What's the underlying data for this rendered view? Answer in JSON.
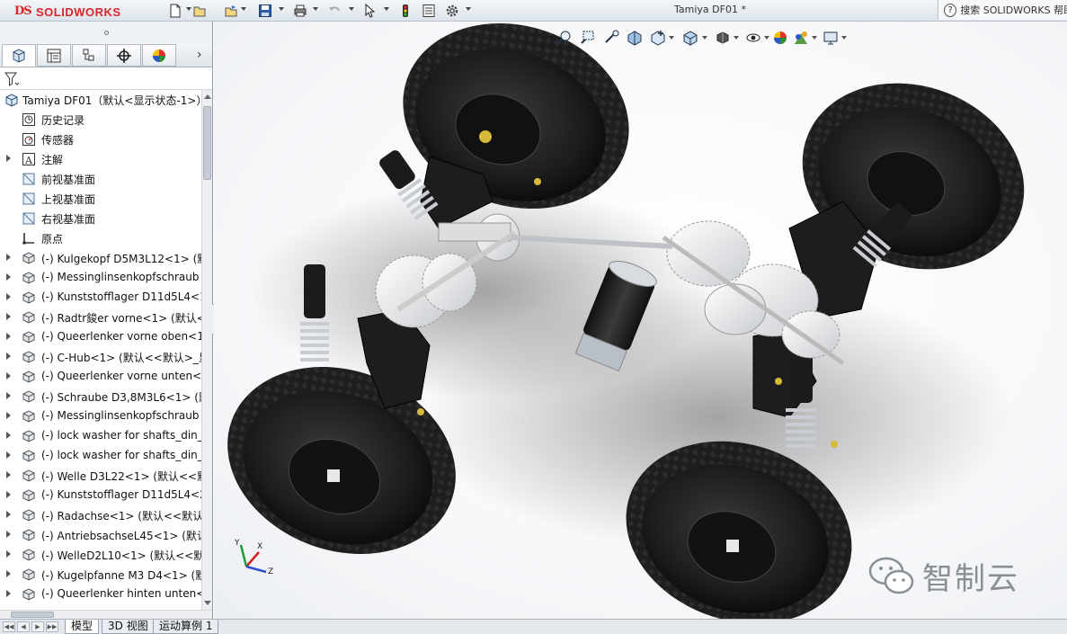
{
  "window": {
    "logo_ds": "DS",
    "logo_brand": "SOLIDWORKS",
    "document_title": "Tamiya DF01 *",
    "search_label": "搜索 SOLIDWORKS 帮助"
  },
  "toolbar": {
    "icons": [
      "new-document-icon",
      "open-folder-icon",
      "save-icon",
      "print-icon",
      "undo-icon",
      "select-arrow-icon",
      "rebuild-traffic-light-icon",
      "file-properties-icon",
      "options-gear-icon"
    ]
  },
  "feature_manager": {
    "tabs": [
      "featuremanager-tree-icon",
      "property-manager-icon",
      "configuration-manager-icon",
      "dimxpert-manager-icon",
      "display-manager-icon"
    ],
    "filter_icon": "filter-funnel-icon",
    "root": "Tamiya DF01（默认<显示状态-1>）",
    "items": [
      {
        "label": "历史记录",
        "icon": "history-icon",
        "expandable": false
      },
      {
        "label": "传感器",
        "icon": "sensor-icon",
        "expandable": false
      },
      {
        "label": "注解",
        "icon": "annotation-icon",
        "expandable": true
      },
      {
        "label": "前视基准面",
        "icon": "plane-icon",
        "expandable": false
      },
      {
        "label": "上视基准面",
        "icon": "plane-icon",
        "expandable": false
      },
      {
        "label": "右视基准面",
        "icon": "plane-icon",
        "expandable": false
      },
      {
        "label": "原点",
        "icon": "origin-icon",
        "expandable": false
      },
      {
        "label": "(-) Kulgekopf D5M3L12<1> (默",
        "icon": "part-icon",
        "expandable": true
      },
      {
        "label": "(-) Messinglinsenkopfschraub",
        "icon": "part-icon",
        "expandable": true
      },
      {
        "label": "(-) Kunststofflager D11d5L4<1",
        "icon": "part-icon",
        "expandable": true
      },
      {
        "label": "(-) Radtr鋑er vorne<1> (默认<",
        "icon": "part-icon",
        "expandable": true
      },
      {
        "label": "(-) Queerlenker vorne oben<1",
        "icon": "part-icon",
        "expandable": true
      },
      {
        "label": "(-) C-Hub<1> (默认<<默认>_显",
        "icon": "part-icon",
        "expandable": true
      },
      {
        "label": "(-) Queerlenker vorne unten<",
        "icon": "part-icon",
        "expandable": true
      },
      {
        "label": "(-) Schraube D3,8M3L6<1> (默",
        "icon": "part-icon",
        "expandable": true
      },
      {
        "label": "(-) Messinglinsenkopfschraub",
        "icon": "part-icon",
        "expandable": true
      },
      {
        "label": "(-) lock washer for shafts_din_",
        "icon": "part-icon",
        "expandable": true
      },
      {
        "label": "(-) lock washer for shafts_din_",
        "icon": "part-icon",
        "expandable": true
      },
      {
        "label": "(-) Welle D3L22<1> (默认<<默",
        "icon": "part-icon",
        "expandable": true
      },
      {
        "label": "(-) Kunststofflager D11d5L4<2",
        "icon": "part-icon",
        "expandable": true
      },
      {
        "label": "(-) Radachse<1> (默认<<默认>",
        "icon": "part-icon",
        "expandable": true
      },
      {
        "label": "(-) AntriebsachseL45<1> (默认",
        "icon": "part-icon",
        "expandable": true
      },
      {
        "label": "(-) WelleD2L10<1> (默认<<默",
        "icon": "part-icon",
        "expandable": true
      },
      {
        "label": "(-) Kugelpfanne M3 D4<1> (默",
        "icon": "part-icon",
        "expandable": true
      },
      {
        "label": "(-) Queerlenker hinten unten<",
        "icon": "part-icon",
        "expandable": true
      }
    ]
  },
  "heads_up_toolbar": {
    "icons": [
      "zoom-to-fit-icon",
      "zoom-to-area-icon",
      "previous-view-icon",
      "section-view-icon",
      "dynamic-annotation-view-icon",
      "view-orientation-icon",
      "display-style-icon",
      "hide-show-items-icon",
      "edit-appearance-icon",
      "apply-scene-icon",
      "view-settings-icon"
    ]
  },
  "viewport": {
    "triad_labels": {
      "x": "X",
      "y": "Y",
      "z": "Z"
    },
    "watermark_text": "智制云",
    "watermark_icon": "wechat-icon"
  },
  "bottom_tabs": {
    "tabs": [
      "模型",
      "3D 视图",
      "运动算例 1"
    ],
    "active": "模型"
  },
  "colors": {
    "brand_red": "#d8262b",
    "tire_black": "#1e1e1e",
    "gear_white": "#ededed",
    "spring_silver": "#c9ccd2",
    "motor_black": "#222222",
    "axis_x_red": "#d02020",
    "axis_y_green": "#1f9a2f",
    "axis_z_blue": "#2a4fd0"
  }
}
